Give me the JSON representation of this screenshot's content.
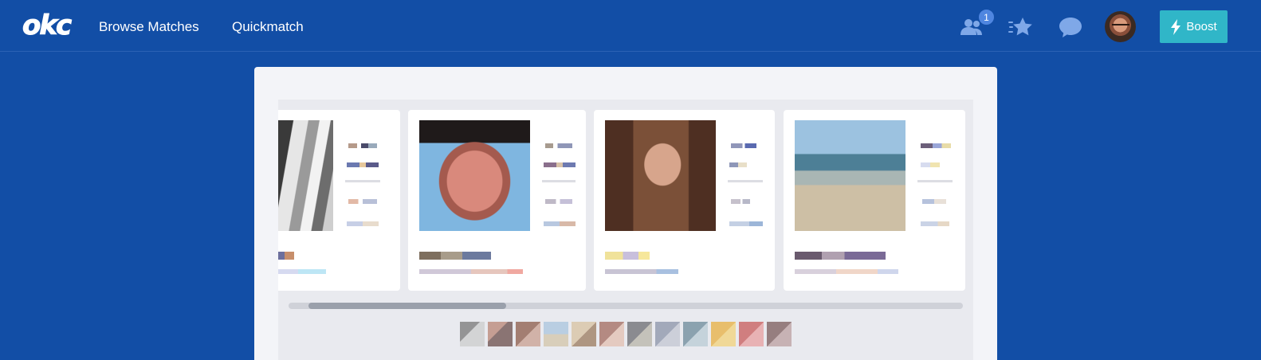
{
  "nav": {
    "logo": "okc",
    "links": [
      {
        "label": "Browse Matches"
      },
      {
        "label": "Quickmatch"
      }
    ],
    "icons": {
      "likes": "people-icon",
      "intros": "star-icon",
      "messages": "chat-icon"
    },
    "likes_badge": "1",
    "boost_label": "Boost",
    "boost_icon": "lightning-icon",
    "accent": "#124ea6",
    "boost_color": "#30b6c8"
  },
  "matches": {
    "cards": [
      {
        "photo": "grayscale",
        "name": "",
        "subtitle": ""
      },
      {
        "photo": "portrait",
        "name": "",
        "subtitle": ""
      },
      {
        "photo": "portrait",
        "name": "",
        "subtitle": ""
      },
      {
        "photo": "beach",
        "name": "",
        "subtitle": ""
      }
    ],
    "thumbnail_count": 12,
    "scroll_position": 0.03
  }
}
